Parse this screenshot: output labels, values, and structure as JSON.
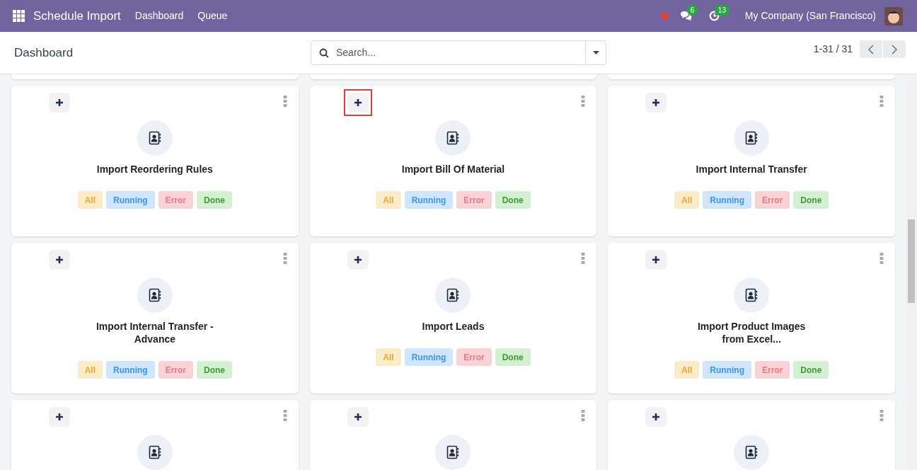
{
  "navbar": {
    "app_title": "Schedule Import",
    "menu": [
      {
        "label": "Dashboard"
      },
      {
        "label": "Queue"
      }
    ],
    "messages_count": "6",
    "activities_count": "13",
    "company": "My Company (San Francisco)"
  },
  "control_panel": {
    "title": "Dashboard",
    "search": {
      "placeholder": "Search..."
    },
    "pager": "1-31 / 31"
  },
  "cards": [
    {
      "title": "Import Reordering Rules",
      "add_highlighted": false,
      "tags": [
        {
          "label": "All",
          "kind": "all"
        },
        {
          "label": "Running",
          "kind": "running"
        },
        {
          "label": "Error",
          "kind": "error"
        },
        {
          "label": "Done",
          "kind": "done"
        }
      ]
    },
    {
      "title": "Import Bill Of Material",
      "add_highlighted": true,
      "tags": [
        {
          "label": "All",
          "kind": "all"
        },
        {
          "label": "Running",
          "kind": "running"
        },
        {
          "label": "Error",
          "kind": "error"
        },
        {
          "label": "Done",
          "kind": "done"
        }
      ]
    },
    {
      "title": "Import Internal Transfer",
      "add_highlighted": false,
      "tags": [
        {
          "label": "All",
          "kind": "all"
        },
        {
          "label": "Running",
          "kind": "running"
        },
        {
          "label": "Error",
          "kind": "error"
        },
        {
          "label": "Done",
          "kind": "done"
        }
      ]
    },
    {
      "title": "Import Internal Transfer - Advance",
      "add_highlighted": false,
      "tags": [
        {
          "label": "All",
          "kind": "all"
        },
        {
          "label": "Running",
          "kind": "running"
        },
        {
          "label": "Error",
          "kind": "error"
        },
        {
          "label": "Done",
          "kind": "done"
        }
      ]
    },
    {
      "title": "Import Leads",
      "add_highlighted": false,
      "tags": [
        {
          "label": "All",
          "kind": "all"
        },
        {
          "label": "Running",
          "kind": "running"
        },
        {
          "label": "Error",
          "kind": "error"
        },
        {
          "label": "Done",
          "kind": "done"
        }
      ]
    },
    {
      "title": "Import Product Images from Excel...",
      "add_highlighted": false,
      "tags": [
        {
          "label": "All",
          "kind": "all"
        },
        {
          "label": "Running",
          "kind": "running"
        },
        {
          "label": "Error",
          "kind": "error"
        },
        {
          "label": "Done",
          "kind": "done"
        }
      ]
    },
    {
      "add_highlighted": false
    },
    {
      "add_highlighted": false
    },
    {
      "add_highlighted": false
    }
  ]
}
